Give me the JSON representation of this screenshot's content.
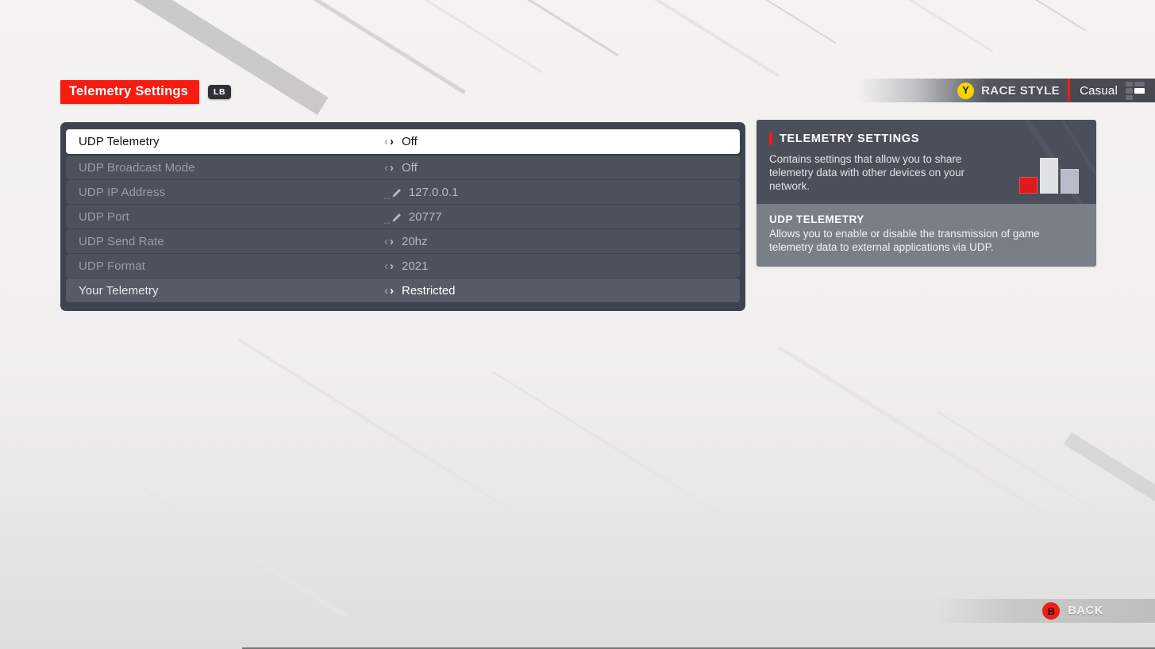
{
  "header": {
    "title": "Telemetry Settings",
    "bumper_hint": "LB"
  },
  "race_style": {
    "button_glyph": "Y",
    "label": "RACE STYLE",
    "value": "Casual"
  },
  "settings": {
    "rows": [
      {
        "label": "UDP Telemetry",
        "value": "Off",
        "control": "stepper",
        "state": "selected"
      },
      {
        "label": "UDP Broadcast Mode",
        "value": "Off",
        "control": "stepper",
        "state": "disabled"
      },
      {
        "label": "UDP IP Address",
        "value": "127.0.0.1",
        "control": "edit",
        "state": "disabled"
      },
      {
        "label": "UDP Port",
        "value": "20777",
        "control": "edit",
        "state": "disabled"
      },
      {
        "label": "UDP Send Rate",
        "value": "20hz",
        "control": "stepper",
        "state": "disabled"
      },
      {
        "label": "UDP Format",
        "value": "2021",
        "control": "stepper",
        "state": "disabled"
      },
      {
        "label": "Your Telemetry",
        "value": "Restricted",
        "control": "stepper",
        "state": "normal"
      }
    ],
    "chevron_left": "‹",
    "chevron_right": "›",
    "edit_dots": "..."
  },
  "info": {
    "title": "TELEMETRY SETTINGS",
    "description": "Contains settings that allow you to share telemetry data with other devices on your network.",
    "sub_title": "UDP TELEMETRY",
    "sub_description": "Allows you to enable or disable the transmission of game telemetry data to external applications via UDP."
  },
  "footer": {
    "back_glyph": "B",
    "back_label": "BACK"
  },
  "colors": {
    "accent_red": "#f91a10",
    "panel_dark": "#3e434f",
    "row_disabled": "#4c515c",
    "row_normal": "#565b66",
    "info_top": "#4b4f5a",
    "info_bottom": "#7a7e87",
    "yellow_button": "#f5d400"
  }
}
